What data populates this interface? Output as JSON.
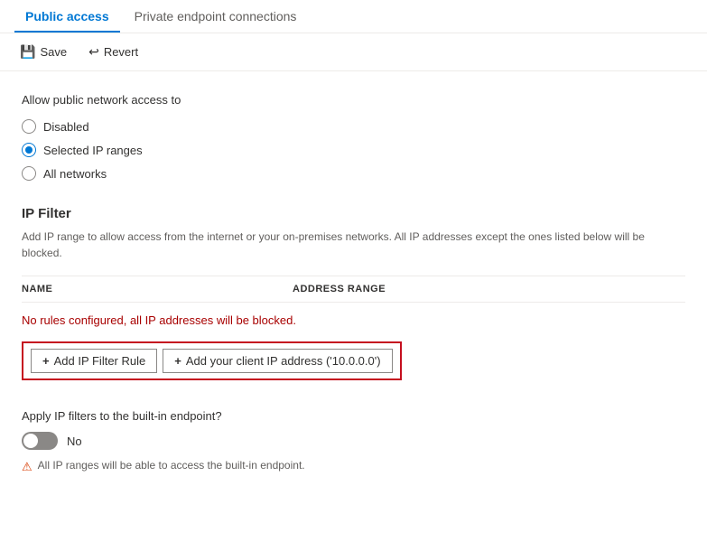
{
  "tabs": [
    {
      "id": "public-access",
      "label": "Public access",
      "active": true
    },
    {
      "id": "private-endpoint",
      "label": "Private endpoint connections",
      "active": false
    }
  ],
  "toolbar": {
    "save_label": "Save",
    "revert_label": "Revert"
  },
  "main": {
    "access_label": "Allow public network access to",
    "radio_options": [
      {
        "id": "disabled",
        "label": "Disabled",
        "selected": false
      },
      {
        "id": "selected-ip-ranges",
        "label": "Selected IP ranges",
        "selected": true
      },
      {
        "id": "all-networks",
        "label": "All networks",
        "selected": false
      }
    ],
    "ip_filter": {
      "title": "IP Filter",
      "description": "Add IP range to allow access from the internet or your on-premises networks. All IP addresses except the ones listed below will be blocked.",
      "table": {
        "col_name": "NAME",
        "col_range": "ADDRESS RANGE"
      },
      "no_rules_message": "No rules configured, all IP addresses will be blocked.",
      "add_filter_btn": "Add IP Filter Rule",
      "add_client_ip_btn": "Add your client IP address ('10.0.0.0')"
    },
    "builtin": {
      "label": "Apply IP filters to the built-in endpoint?",
      "toggle_state": "off",
      "toggle_text": "No",
      "warning": "All IP ranges will be able to access the built-in endpoint."
    }
  }
}
